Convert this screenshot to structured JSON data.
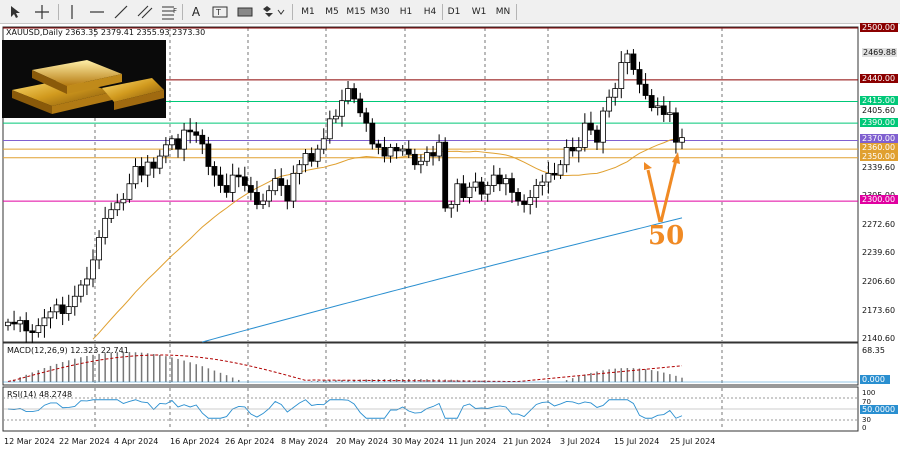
{
  "toolbar": {
    "timeframes": [
      "M1",
      "M5",
      "M15",
      "M30",
      "H1",
      "H4",
      "D1",
      "W1",
      "MN"
    ],
    "icons": [
      "cursor-icon",
      "crosshair-icon",
      "vertical-line-icon",
      "horizontal-line-icon",
      "trendline-icon",
      "channel-icon",
      "fibonacci-icon",
      "text-icon",
      "label-icon",
      "rectangle-icon",
      "shapes-icon"
    ]
  },
  "header": {
    "symbol_line": "XAUUSD,Daily  2363.35 2379.41 2355.93 2373.30"
  },
  "annotation": {
    "text": "50"
  },
  "price_axis": {
    "ticks": [
      "2469.88",
      "2405.60",
      "2339.60",
      "2305.00",
      "2272.60",
      "2239.60",
      "2206.60",
      "2173.60",
      "2140.60"
    ],
    "levels": [
      {
        "value": "2500.00",
        "color": "#8b0000"
      },
      {
        "value": "2440.00",
        "color": "#8b0000"
      },
      {
        "value": "2415.00",
        "color": "#00c878"
      },
      {
        "value": "2390.00",
        "color": "#00c878"
      },
      {
        "value": "2370.00",
        "color": "#8060d0"
      },
      {
        "value": "2360.00",
        "color": "#e0a030"
      },
      {
        "value": "2350.00",
        "color": "#e0a030"
      },
      {
        "value": "2300.00",
        "color": "#e000a0"
      }
    ]
  },
  "macd": {
    "label": "MACD(12,26,9) 12.323 22.741",
    "ticks": [
      "68.35"
    ],
    "zero": "0.000"
  },
  "rsi": {
    "label": "RSI(14) 48.2748",
    "ticks": [
      "100",
      "70",
      "30",
      "0"
    ],
    "level": "50.0000"
  },
  "time_axis": {
    "labels": [
      "12 Mar 2024",
      "22 Mar 2024",
      "4 Apr 2024",
      "16 Apr 2024",
      "26 Apr 2024",
      "8 May 2024",
      "20 May 2024",
      "30 May 2024",
      "11 Jun 2024",
      "21 Jun 2024",
      "3 Jul 2024",
      "15 Jul 2024",
      "25 Jul 2024"
    ]
  },
  "colors": {
    "ma_slow": "#2a8fd0",
    "ma_fast": "#e0a030",
    "arrow": "#f08a24",
    "macd_signal": "#b00000"
  },
  "chart_data": {
    "type": "candlestick",
    "symbol": "XAUUSD",
    "timeframe": "Daily",
    "last_bar": {
      "open": 2363.35,
      "high": 2379.41,
      "low": 2355.93,
      "close": 2373.3
    },
    "closes": [
      2160,
      2158,
      2162,
      2150,
      2148,
      2156,
      2165,
      2172,
      2180,
      2170,
      2178,
      2190,
      2203,
      2210,
      2232,
      2258,
      2280,
      2290,
      2298,
      2302,
      2320,
      2340,
      2330,
      2345,
      2338,
      2352,
      2365,
      2372,
      2360,
      2382,
      2380,
      2376,
      2366,
      2340,
      2330,
      2318,
      2310,
      2330,
      2328,
      2318,
      2310,
      2296,
      2300,
      2312,
      2326,
      2318,
      2300,
      2332,
      2342,
      2355,
      2346,
      2360,
      2372,
      2395,
      2398,
      2416,
      2430,
      2418,
      2402,
      2390,
      2366,
      2362,
      2352,
      2362,
      2358,
      2360,
      2354,
      2342,
      2346,
      2356,
      2352,
      2368,
      2292,
      2296,
      2320,
      2304,
      2316,
      2322,
      2308,
      2318,
      2330,
      2320,
      2326,
      2310,
      2300,
      2296,
      2304,
      2318,
      2322,
      2332,
      2330,
      2342,
      2362,
      2358,
      2362,
      2390,
      2382,
      2368,
      2404,
      2420,
      2430,
      2460,
      2470,
      2452,
      2435,
      2422,
      2408,
      2410,
      2400,
      2402,
      2368,
      2373.3
    ],
    "ma_fast_period": 50,
    "ma_slow_period": 200
  }
}
